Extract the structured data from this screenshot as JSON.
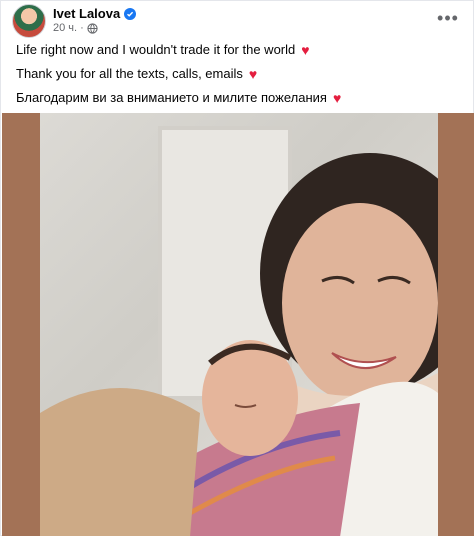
{
  "post": {
    "author": "Ivet Lalova",
    "time": "20 ч.",
    "icons": {
      "verified": "verified-badge-icon",
      "audience": "globe-icon",
      "more": "more-options-icon",
      "heart": "red-heart-icon"
    },
    "lines": [
      "Life right now and I wouldn't trade it for the world",
      "Thank you for all the texts, calls, emails",
      "Благодарим ви за вниманието и милите пожелания"
    ]
  },
  "colors": {
    "accent": "#1877f2",
    "heart": "#e41e3f",
    "media_frame": "#a37256",
    "secondary_text": "#65676b"
  }
}
